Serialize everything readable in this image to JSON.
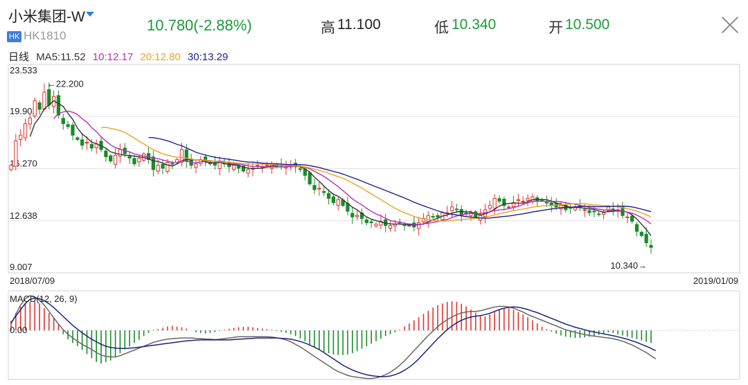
{
  "header": {
    "stock_name": "小米集团-W",
    "market_badge": "HK",
    "code": "HK1810",
    "price": "10.780",
    "change": "(-2.88%)",
    "high_label": "高",
    "high_value": "11.100",
    "low_label": "低",
    "low_value": "10.340",
    "open_label": "开",
    "open_value": "10.500",
    "close_icon": "close-icon",
    "dropdown_icon": "chevron-down-icon"
  },
  "colors": {
    "up": "#e0322c",
    "down": "#1a8a2a",
    "ma5": "#333333",
    "ma10": "#b52ec2",
    "ma20": "#f0a020",
    "ma30": "#1f1f8f",
    "dif": "#666666",
    "dea": "#1a237e"
  },
  "chart_data": [
    {
      "type": "candlestick",
      "period_label": "日线",
      "legend": [
        {
          "name": "MA5",
          "value": "11.52",
          "text": "MA5:11.52",
          "color": "#333333"
        },
        {
          "name": "MA10",
          "value": "12.17",
          "text": "10:12.17",
          "color": "#b52ec2"
        },
        {
          "name": "MA20",
          "value": "12.80",
          "text": "20:12.80",
          "color": "#f0a020"
        },
        {
          "name": "MA30",
          "value": "13.29",
          "text": "30:13.29",
          "color": "#1f1f8f"
        }
      ],
      "y_ticks": [
        "23.533",
        "19.902",
        "16.270",
        "12.638",
        "9.007"
      ],
      "ylim": [
        9.007,
        23.533
      ],
      "x_start_label": "2018/07/09",
      "x_end_label": "2019/01/09",
      "max_annotation": {
        "text": "←22.200",
        "value": 22.2,
        "index": 7
      },
      "min_annotation": {
        "text": "10.340→",
        "value": 10.34,
        "index": 134
      },
      "closes": [
        16.5,
        18.2,
        18.6,
        19.4,
        19.8,
        21.0,
        20.4,
        21.6,
        20.7,
        21.3,
        20.0,
        19.4,
        19.2,
        18.6,
        18.3,
        17.9,
        18.1,
        17.7,
        18.0,
        17.6,
        17.1,
        16.8,
        17.2,
        17.6,
        17.3,
        17.0,
        16.6,
        17.0,
        17.3,
        16.9,
        16.2,
        16.5,
        16.3,
        16.7,
        16.6,
        16.9,
        17.6,
        16.8,
        16.5,
        16.6,
        16.9,
        16.8,
        16.6,
        16.5,
        16.7,
        16.6,
        16.4,
        16.5,
        16.3,
        16.1,
        16.2,
        16.3,
        16.5,
        16.4,
        16.5,
        16.6,
        16.4,
        16.5,
        16.4,
        16.5,
        16.4,
        16.2,
        15.8,
        15.2,
        14.8,
        14.9,
        14.6,
        14.2,
        13.9,
        14.1,
        13.7,
        13.3,
        12.9,
        13.0,
        12.8,
        12.5,
        12.5,
        12.4,
        12.6,
        12.3,
        12.3,
        12.4,
        12.5,
        12.3,
        12.3,
        12.2,
        12.5,
        12.8,
        13.0,
        12.9,
        12.9,
        13.2,
        13.2,
        13.6,
        13.4,
        13.0,
        13.1,
        13.2,
        12.9,
        13.0,
        13.4,
        13.7,
        14.2,
        14.0,
        13.7,
        13.6,
        13.9,
        14.1,
        14.0,
        14.2,
        14.3,
        14.0,
        14.1,
        13.9,
        13.7,
        13.6,
        13.7,
        13.4,
        13.5,
        13.6,
        13.6,
        13.4,
        13.2,
        13.3,
        13.1,
        13.2,
        13.6,
        13.3,
        13.4,
        13.0,
        12.9,
        12.6,
        11.9,
        11.6,
        11.1,
        10.78
      ]
    },
    {
      "type": "macd",
      "title": "MACD(12, 26, 9)",
      "zero_label": "0.00",
      "zero_value": 0,
      "ylim": [
        -1.55,
        1.25
      ],
      "hist": [
        0.3,
        0.55,
        0.75,
        0.85,
        0.9,
        0.92,
        0.85,
        0.7,
        0.55,
        0.4,
        0.2,
        -0.12,
        -0.28,
        -0.4,
        -0.5,
        -0.62,
        -0.75,
        -0.88,
        -1.0,
        -1.05,
        -1.0,
        -0.95,
        -0.85,
        -0.72,
        -0.6,
        -0.5,
        -0.4,
        -0.3,
        -0.18,
        -0.08,
        0.02,
        0.04,
        0.08,
        0.12,
        0.14,
        0.12,
        0.1,
        0.06,
        0.0,
        -0.06,
        -0.08,
        -0.1,
        -0.08,
        -0.05,
        -0.02,
        0.02,
        0.05,
        0.08,
        0.1,
        0.11,
        0.12,
        0.1,
        0.08,
        0.06,
        0.04,
        0.02,
        -0.02,
        -0.05,
        -0.08,
        -0.12,
        -0.18,
        -0.26,
        -0.34,
        -0.44,
        -0.52,
        -0.6,
        -0.68,
        -0.72,
        -0.76,
        -0.78,
        -0.78,
        -0.76,
        -0.72,
        -0.66,
        -0.58,
        -0.5,
        -0.42,
        -0.34,
        -0.26,
        -0.18,
        -0.12,
        -0.06,
        0.02,
        0.12,
        0.22,
        0.32,
        0.42,
        0.52,
        0.62,
        0.72,
        0.8,
        0.85,
        0.9,
        0.92,
        0.9,
        0.84,
        0.76,
        0.66,
        0.56,
        0.48,
        0.44,
        0.5,
        0.58,
        0.66,
        0.7,
        0.7,
        0.65,
        0.58,
        0.5,
        0.42,
        0.32,
        0.22,
        0.12,
        0.04,
        -0.04,
        -0.1,
        -0.16,
        -0.2,
        -0.22,
        -0.24,
        -0.24,
        -0.22,
        -0.2,
        -0.18,
        -0.14,
        -0.1,
        -0.06,
        -0.08,
        -0.12,
        -0.16,
        -0.2,
        -0.24,
        -0.28,
        -0.32,
        -0.36,
        -0.4
      ],
      "dif": [
        0.2,
        0.5,
        0.8,
        1.0,
        1.1,
        1.05,
        0.95,
        0.8,
        0.6,
        0.4,
        0.2,
        0.02,
        -0.12,
        -0.24,
        -0.34,
        -0.44,
        -0.52,
        -0.6,
        -0.7,
        -0.78,
        -0.82,
        -0.84,
        -0.84,
        -0.8,
        -0.74,
        -0.68,
        -0.62,
        -0.56,
        -0.5,
        -0.44,
        -0.38,
        -0.34,
        -0.3,
        -0.28,
        -0.26,
        -0.25,
        -0.24,
        -0.24,
        -0.24,
        -0.25,
        -0.26,
        -0.27,
        -0.28,
        -0.29,
        -0.28,
        -0.26,
        -0.24,
        -0.22,
        -0.2,
        -0.2,
        -0.2,
        -0.2,
        -0.2,
        -0.2,
        -0.2,
        -0.21,
        -0.23,
        -0.26,
        -0.3,
        -0.36,
        -0.44,
        -0.52,
        -0.62,
        -0.72,
        -0.82,
        -0.92,
        -1.02,
        -1.12,
        -1.22,
        -1.3,
        -1.36,
        -1.42,
        -1.46,
        -1.48,
        -1.5,
        -1.52,
        -1.52,
        -1.5,
        -1.46,
        -1.4,
        -1.32,
        -1.22,
        -1.1,
        -0.96,
        -0.8,
        -0.64,
        -0.48,
        -0.32,
        -0.16,
        -0.02,
        0.12,
        0.24,
        0.34,
        0.42,
        0.5,
        0.55,
        0.58,
        0.6,
        0.6,
        0.62,
        0.66,
        0.7,
        0.74,
        0.76,
        0.76,
        0.74,
        0.7,
        0.64,
        0.58,
        0.5,
        0.44,
        0.38,
        0.32,
        0.26,
        0.2,
        0.14,
        0.08,
        0.02,
        -0.02,
        -0.06,
        -0.1,
        -0.13,
        -0.16,
        -0.18,
        -0.2,
        -0.22,
        -0.24,
        -0.26,
        -0.3,
        -0.34,
        -0.4,
        -0.46,
        -0.54,
        -0.62,
        -0.7,
        -0.8,
        -0.9
      ],
      "dea": [
        0.25,
        0.45,
        0.65,
        0.85,
        0.98,
        1.02,
        1.0,
        0.94,
        0.84,
        0.72,
        0.58,
        0.44,
        0.3,
        0.16,
        0.04,
        -0.08,
        -0.18,
        -0.28,
        -0.36,
        -0.44,
        -0.5,
        -0.54,
        -0.56,
        -0.57,
        -0.57,
        -0.56,
        -0.55,
        -0.53,
        -0.51,
        -0.49,
        -0.47,
        -0.45,
        -0.43,
        -0.41,
        -0.39,
        -0.37,
        -0.35,
        -0.33,
        -0.32,
        -0.31,
        -0.3,
        -0.3,
        -0.3,
        -0.3,
        -0.3,
        -0.3,
        -0.3,
        -0.29,
        -0.28,
        -0.27,
        -0.26,
        -0.25,
        -0.24,
        -0.24,
        -0.24,
        -0.24,
        -0.24,
        -0.25,
        -0.26,
        -0.28,
        -0.31,
        -0.35,
        -0.4,
        -0.46,
        -0.53,
        -0.61,
        -0.7,
        -0.8,
        -0.9,
        -1.0,
        -1.1,
        -1.18,
        -1.25,
        -1.31,
        -1.36,
        -1.4,
        -1.43,
        -1.45,
        -1.46,
        -1.46,
        -1.44,
        -1.4,
        -1.34,
        -1.26,
        -1.16,
        -1.04,
        -0.9,
        -0.74,
        -0.58,
        -0.42,
        -0.26,
        -0.12,
        0.02,
        0.14,
        0.24,
        0.32,
        0.38,
        0.42,
        0.45,
        0.47,
        0.5,
        0.54,
        0.6,
        0.66,
        0.7,
        0.73,
        0.74,
        0.73,
        0.7,
        0.66,
        0.61,
        0.56,
        0.5,
        0.44,
        0.38,
        0.32,
        0.26,
        0.2,
        0.15,
        0.1,
        0.06,
        0.02,
        -0.02,
        -0.05,
        -0.08,
        -0.11,
        -0.14,
        -0.17,
        -0.2,
        -0.24,
        -0.28,
        -0.33,
        -0.38,
        -0.44,
        -0.5,
        -0.57,
        -0.64
      ]
    }
  ]
}
